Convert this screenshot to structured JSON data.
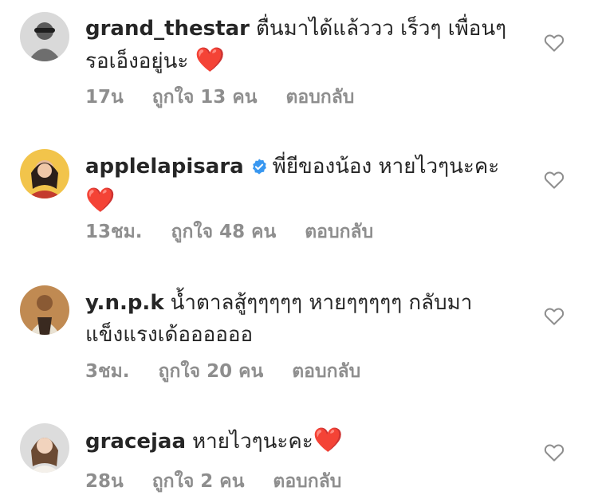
{
  "comments": [
    {
      "username": "grand_thestar",
      "verified": false,
      "text": "ตื่นมาได้แล้ววว เร็วๆ เพื่อนๆ รอเอ็งอยู่นะ",
      "emoji": "❤️",
      "time": "17น",
      "likes": "ถูกใจ 13 คน",
      "reply": "ตอบกลับ"
    },
    {
      "username": "applelapisara",
      "verified": true,
      "text": "พี่ยีของน้อง หายไวๆนะคะ",
      "emoji": "❤️",
      "time": "13ชม.",
      "likes": "ถูกใจ 48 คน",
      "reply": "ตอบกลับ"
    },
    {
      "username": "y.n.p.k",
      "verified": false,
      "text": "น้ำตาลสู้ๆๆๆๆๆ หายๆๆๆๆๆ กลับมาแข็งแรงเด้ออออออ",
      "emoji": "",
      "time": "3ชม.",
      "likes": "ถูกใจ 20 คน",
      "reply": "ตอบกลับ"
    },
    {
      "username": "gracejaa",
      "verified": false,
      "text": "หายไวๆนะคะ",
      "emoji": "❤️",
      "time": "28น",
      "likes": "ถูกใจ 2 คน",
      "reply": "ตอบกลับ"
    }
  ]
}
